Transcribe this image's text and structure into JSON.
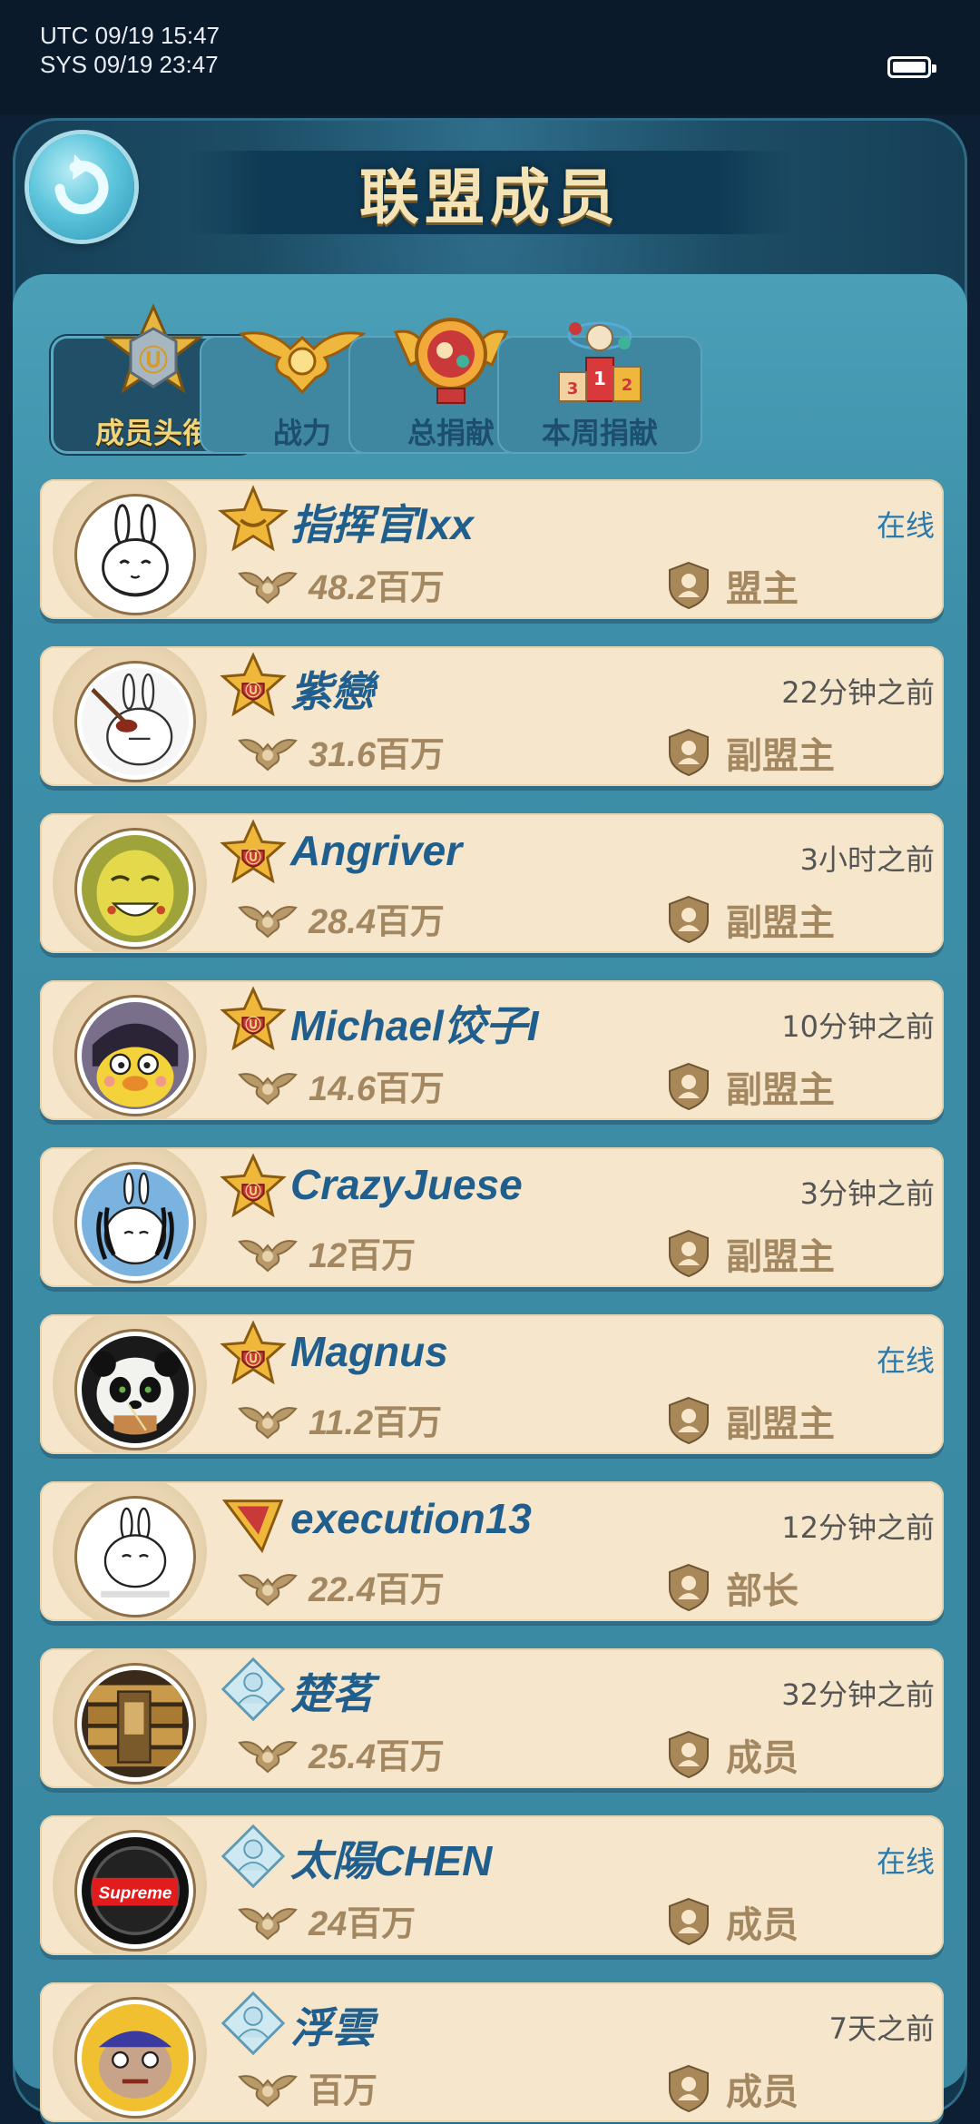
{
  "status_bar": {
    "utc_time": "UTC 09/19 15:47",
    "sys_time": "SYS 09/19 23:47"
  },
  "header": {
    "title": "联盟成员",
    "back_icon": "back-arrow-icon"
  },
  "tabs": [
    {
      "label": "成员头衔",
      "icon": "rank-badge-icon",
      "active": true
    },
    {
      "label": "战力",
      "icon": "eagle-emblem-icon",
      "active": false
    },
    {
      "label": "总捐献",
      "icon": "medal-icon",
      "active": false
    },
    {
      "label": "本周捐献",
      "icon": "podium-icon",
      "active": false
    }
  ],
  "members": [
    {
      "name": "指挥官lxx",
      "status": "在线",
      "online": true,
      "power_num": "48.2",
      "power_unit": "百万",
      "role": "盟主",
      "rank_icon": "commander-star-icon",
      "avatar": "bunny-avatar"
    },
    {
      "name": "紫戀",
      "status": "22分钟之前",
      "online": false,
      "power_num": "31.6",
      "power_unit": "百万",
      "role": "副盟主",
      "rank_icon": "vice-leader-badge-icon",
      "avatar": "bunny-plunger-avatar"
    },
    {
      "name": "Angriver",
      "status": "3小时之前",
      "online": false,
      "power_num": "28.4",
      "power_unit": "百万",
      "role": "副盟主",
      "rank_icon": "vice-leader-badge-icon",
      "avatar": "yellow-face-avatar"
    },
    {
      "name": "Michael饺子I",
      "status": "10分钟之前",
      "online": false,
      "power_num": "14.6",
      "power_unit": "百万",
      "role": "副盟主",
      "rank_icon": "vice-leader-badge-icon",
      "avatar": "duck-avatar"
    },
    {
      "name": "CrazyJuese",
      "status": "3分钟之前",
      "online": false,
      "power_num": "12",
      "power_unit": "百万",
      "role": "副盟主",
      "rank_icon": "vice-leader-badge-icon",
      "avatar": "bunny-dreadlocks-avatar"
    },
    {
      "name": "Magnus",
      "status": "在线",
      "online": true,
      "power_num": "11.2",
      "power_unit": "百万",
      "role": "副盟主",
      "rank_icon": "vice-leader-badge-icon",
      "avatar": "panda-avatar"
    },
    {
      "name": "execution13",
      "status": "12分钟之前",
      "online": false,
      "power_num": "22.4",
      "power_unit": "百万",
      "role": "部长",
      "rank_icon": "minister-badge-icon",
      "avatar": "bunny-text-avatar"
    },
    {
      "name": "楚茗",
      "status": "32分钟之前",
      "online": false,
      "power_num": "25.4",
      "power_unit": "百万",
      "role": "成员",
      "rank_icon": "member-badge-icon",
      "avatar": "gold-bars-avatar"
    },
    {
      "name": "太陽CHEN",
      "status": "在线",
      "online": true,
      "power_num": "24",
      "power_unit": "百万",
      "role": "成员",
      "rank_icon": "member-badge-icon",
      "avatar": "supreme-avatar",
      "avatar_text": "Supreme"
    },
    {
      "name": "浮雲",
      "status": "7天之前",
      "online": false,
      "power_num": "",
      "power_unit": "百万",
      "role": "成员",
      "rank_icon": "member-badge-icon",
      "avatar": "cartoon-character-avatar"
    }
  ],
  "colors": {
    "name_blue": "#1f5e8d",
    "row_bg": "#f6e7cc",
    "active_tab_text": "#f2d57a",
    "detail_gold": "#a38760"
  }
}
